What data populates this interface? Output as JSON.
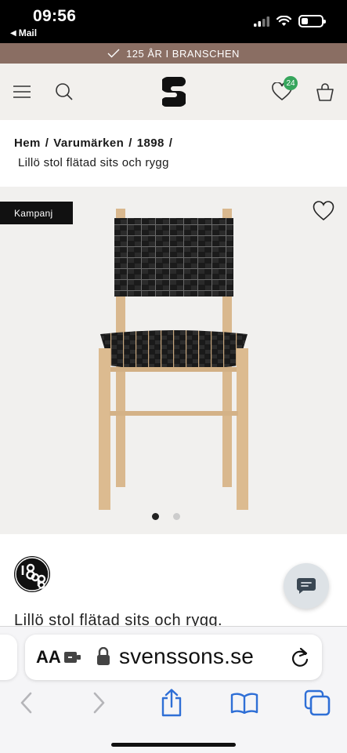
{
  "status_bar": {
    "time": "09:56",
    "back_label": "Mail",
    "battery_level": 0.35
  },
  "promo": {
    "text": "125 ÅR I BRANSCHEN",
    "icon": "checkmark-icon"
  },
  "header": {
    "menu_icon": "hamburger-menu-icon",
    "search_icon": "search-icon",
    "logo_icon": "svenssons-logo-icon",
    "wishlist_count": "24",
    "cart_icon": "shopping-bag-icon"
  },
  "breadcrumb": {
    "items": [
      "Hem",
      "Varumärken",
      "1898"
    ],
    "separator": "/",
    "current": "Lillö stol flätad sits och rygg"
  },
  "gallery": {
    "badge": "Kampanj",
    "image_count": 2,
    "active_index": 0
  },
  "product": {
    "brand_logo": "1898-brand-logo",
    "title": "Lillö stol flätad sits och rygg."
  },
  "safari": {
    "text_size_label": "AA",
    "url": "svenssons.se"
  },
  "colors": {
    "promo_bg": "#8a6e63",
    "header_bg": "#f2f0ed",
    "badge_green": "#37a55c",
    "ios_blue": "#2f6fd6"
  }
}
